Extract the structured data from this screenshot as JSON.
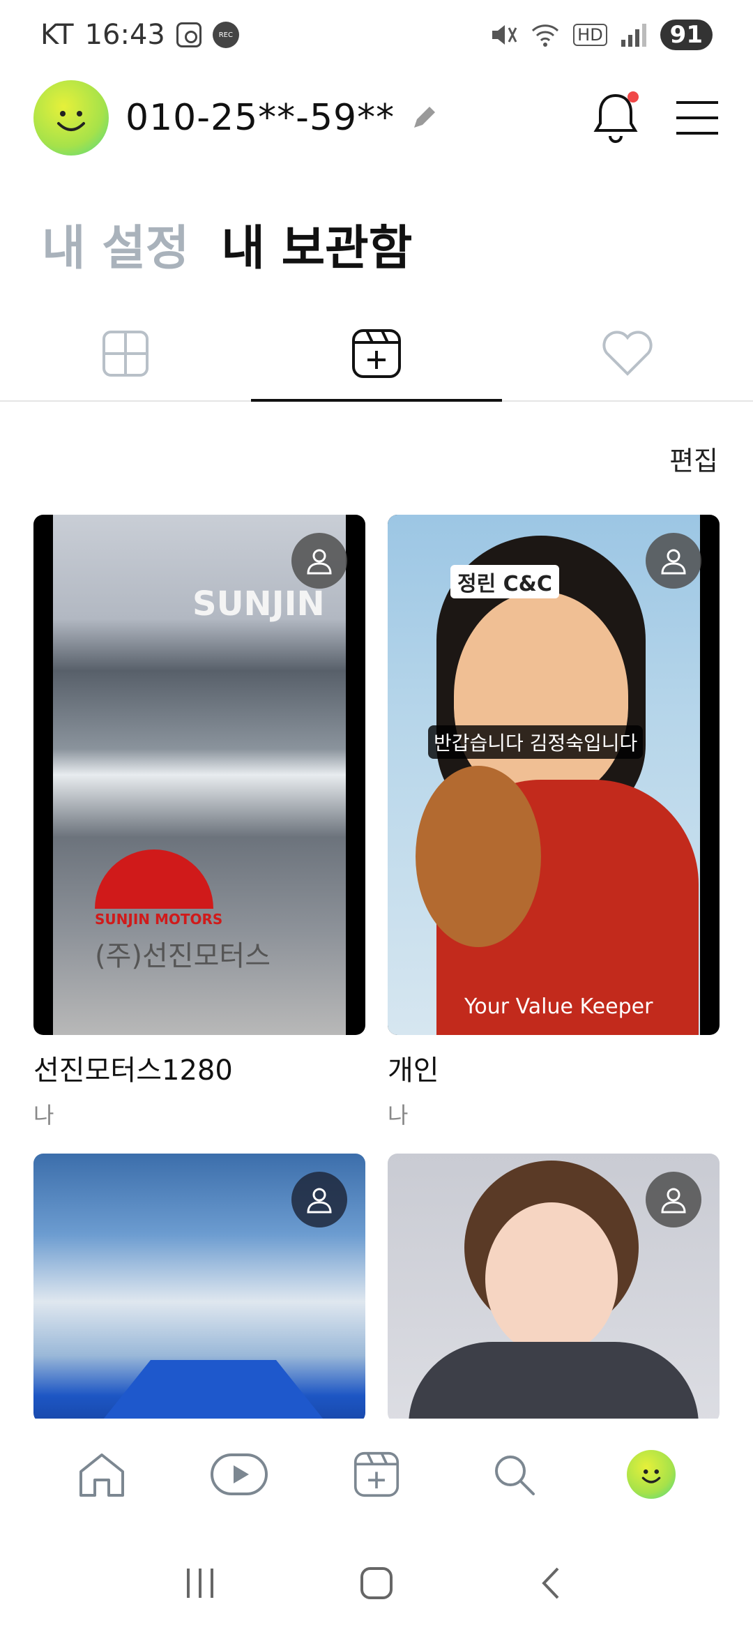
{
  "status_bar": {
    "carrier": "KT",
    "time": "16:43",
    "rec_label": "REC",
    "network": "HD",
    "battery": "91"
  },
  "header": {
    "phone": "010-25**-59**"
  },
  "section_tabs": {
    "settings": "내 설정",
    "storage": "내 보관함"
  },
  "icon_tabs": [
    "grid-icon",
    "add-reel-icon",
    "heart-icon"
  ],
  "edit_label": "편집",
  "cards": [
    {
      "title": "선진모터스1280",
      "owner": "나",
      "overlay_brand": "SUNJIN",
      "overlay_logo": "SUNJIN MOTORS",
      "overlay_name": "(주)선진모터스"
    },
    {
      "title": "개인",
      "owner": "나",
      "overlay_brand": "정린 C&C",
      "overlay_caption": "반갑습니다 김정숙입니다",
      "overlay_slogan": "Your Value Keeper"
    },
    {
      "title": "",
      "owner": ""
    },
    {
      "title": "",
      "owner": ""
    }
  ],
  "bottom_nav": [
    "home-icon",
    "play-icon",
    "add-reel-icon",
    "search-icon",
    "profile-avatar"
  ],
  "colors": {
    "accent": "#111111",
    "muted": "#a9b2bb",
    "notification": "#f04848"
  }
}
